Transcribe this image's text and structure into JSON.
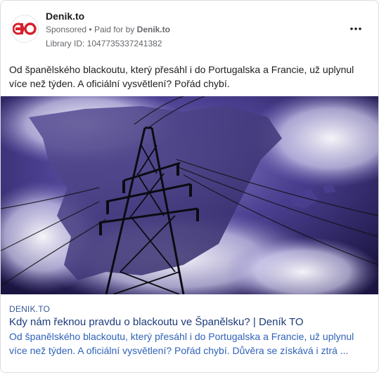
{
  "ad": {
    "page_name": "Denik.to",
    "sponsored_label": "Sponsored",
    "separator": "•",
    "paid_for_by_label": "Paid for by",
    "paid_for_by_name": "Denik.to",
    "library_id": "Library ID: 1047735337241382",
    "more_options_icon": "more-horizontal-icon",
    "logo_text": "TO",
    "logo_color": "#d6202b",
    "post_text": "Od španělského blackoutu, který přesáhl i do Portugalska a Francie, už uplynul více než týden. A oficiální vysvětlení? Pořád chybí.",
    "media_description_icon": "power-pylon-over-spain-map-image",
    "link": {
      "domain": "DENIK.TO",
      "title": "Kdy nám řeknou pravdu o blackoutu ve Španělsku? | Deník TO",
      "description": "Od španělského blackoutu, který přesáhl i do Portugalska a Francie, už uplynul více než týden. A oficiální vysvětlení? Pořád chybí. Důvěra se získává i ztrá ..."
    }
  }
}
